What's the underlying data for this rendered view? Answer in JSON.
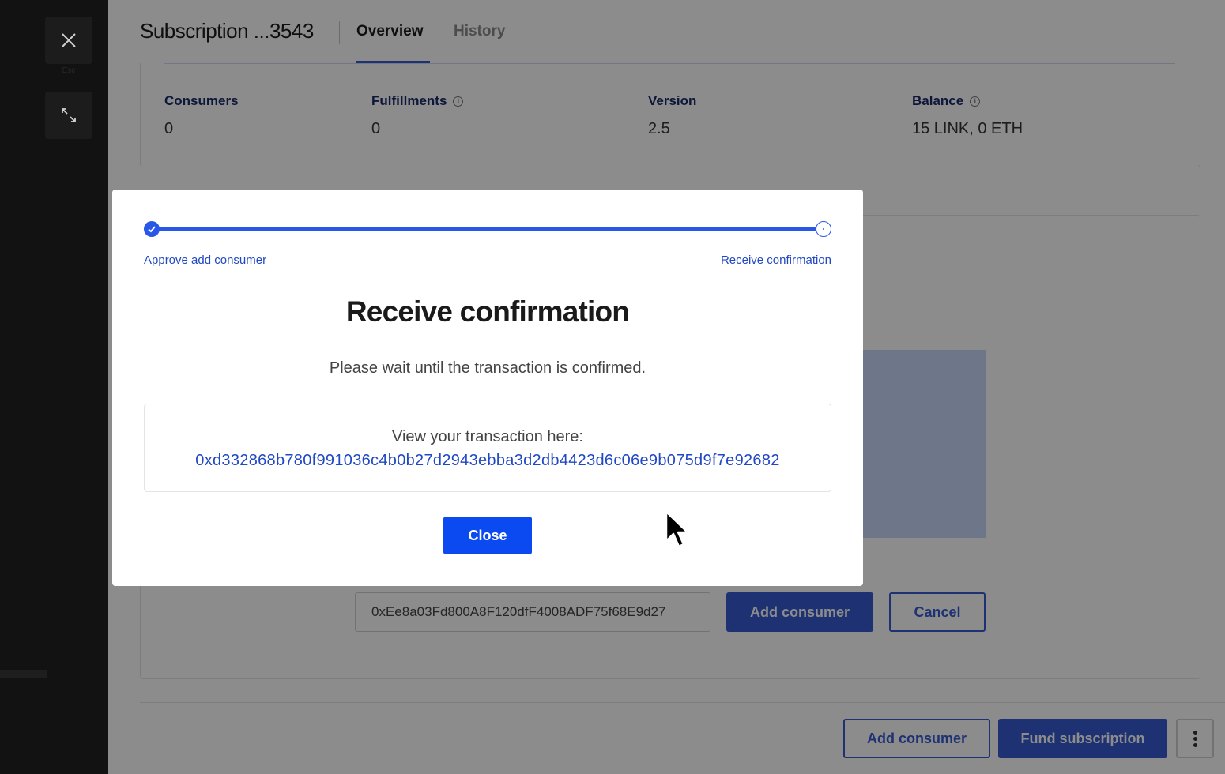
{
  "rail": {
    "esc_label": "Esc"
  },
  "header": {
    "title": "Subscription ...3543",
    "tabs": [
      {
        "label": "Overview"
      },
      {
        "label": "History"
      }
    ]
  },
  "stats": {
    "consumers": {
      "label": "Consumers",
      "value": "0"
    },
    "fulfillments": {
      "label": "Fulfillments",
      "value": "0"
    },
    "version": {
      "label": "Version",
      "value": "2.5"
    },
    "balance": {
      "label": "Balance",
      "value": "15 LINK, 0 ETH"
    }
  },
  "add_consumer_form": {
    "address_value": "0xEe8a03Fd800A8F120dfF4008ADF75f68E9d27",
    "submit_label": "Add consumer",
    "cancel_label": "Cancel"
  },
  "footer": {
    "add_consumer_label": "Add consumer",
    "fund_label": "Fund subscription"
  },
  "modal": {
    "steps": [
      {
        "label": "Approve add consumer"
      },
      {
        "label": "Receive confirmation"
      }
    ],
    "progress": 1.0,
    "title": "Receive confirmation",
    "subtitle": "Please wait until the transaction is confirmed.",
    "tx_label": "View your transaction here:",
    "tx_hash": "0xd332868b780f991036c4b0b27d2943ebba3d2db4423d6c06e9b075d9f7e92682",
    "close_label": "Close"
  },
  "colors": {
    "accent": "#375bd2",
    "link": "#2148c4",
    "primary_button": "#0a4af0"
  }
}
